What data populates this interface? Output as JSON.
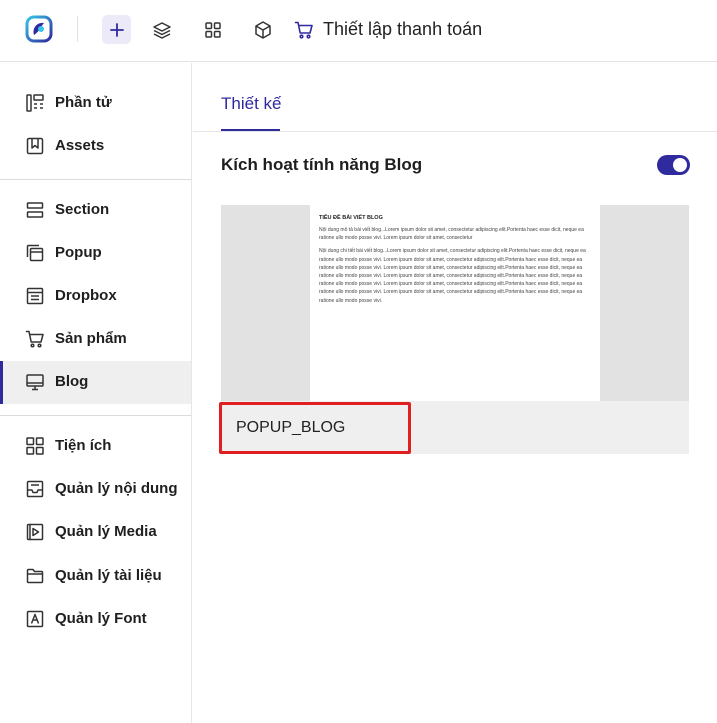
{
  "header": {
    "title": "Thiết lập thanh toán",
    "buttons": [
      "plus-icon",
      "layers-icon",
      "grid-icon",
      "box-icon",
      "cart-icon"
    ]
  },
  "sidebar": {
    "groups": [
      [
        {
          "label": "Phần tử",
          "icon": "elements-icon"
        },
        {
          "label": "Assets",
          "icon": "bookmark-icon"
        }
      ],
      [
        {
          "label": "Section",
          "icon": "section-icon"
        },
        {
          "label": "Popup",
          "icon": "popup-icon"
        },
        {
          "label": "Dropbox",
          "icon": "dropbox-icon"
        },
        {
          "label": "Sản phẩm",
          "icon": "cart-icon"
        },
        {
          "label": "Blog",
          "icon": "monitor-icon",
          "active": true
        }
      ],
      [
        {
          "label": "Tiện ích",
          "icon": "widgets-icon"
        },
        {
          "label": "Quản lý nội dung",
          "icon": "inbox-icon"
        },
        {
          "label": "Quản lý Media",
          "icon": "media-icon"
        },
        {
          "label": "Quản lý tài liệu",
          "icon": "folder-icon"
        },
        {
          "label": "Quản lý Font",
          "icon": "font-icon"
        }
      ]
    ]
  },
  "main": {
    "tab": "Thiết kế",
    "blog_toggle": {
      "label": "Kích hoạt tính năng Blog",
      "enabled": true
    },
    "template_card": {
      "name": "POPUP_BLOG",
      "preview": {
        "heading": "TIÊU ĐỀ BÀI VIẾT BLOG",
        "summary": "Nội dung mô tả bài viết blog...Lorem ipsum dolor sit amet, consectetur adipiscing elit.Portenta haec esse dicit, neque ea ratione ullo modo posse vivi. Lorem ipsum dolor sit amet, consectetur",
        "body": "Nội dung chi tiết bài viết blog...Lorem ipsum dolor sit amet, consectetur adipiscing elit.Portenta haec esse dicit, neque ea ratione ullo modo posse vivi. Lorem ipsum dolor sit amet, consectetur adipiscing elit.Portenta haec esse dicit, neque ea ratione ullo modo posse vivi. Lorem ipsum dolor sit amet, consectetur adipiscing elit.Portenta haec esse dicit, neque ea ratione ullo modo posse vivi. Lorem ipsum dolor sit amet, consectetur adipiscing elit.Portenta haec esse dicit, neque ea ratione ullo modo posse vivi. Lorem ipsum dolor sit amet, consectetur adipiscing elit.Portenta haec esse dicit, neque ea ratione ullo modo posse vivi. Lorem ipsum dolor sit amet, consectetur adipiscing elit.Portenta haec esse dicit, neque ea ratione ullo modo posse vivi."
      }
    }
  },
  "colors": {
    "accent": "#2f2a9e",
    "highlight": "#e02020",
    "active_bg": "#efefef"
  }
}
